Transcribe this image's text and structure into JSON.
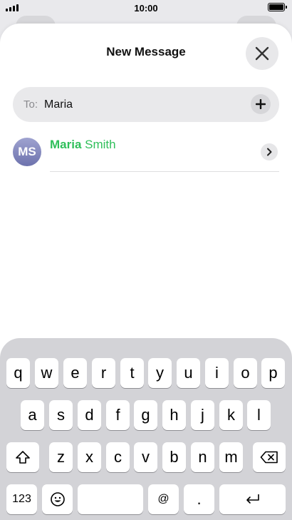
{
  "status": {
    "time": "10:00"
  },
  "sheet": {
    "title": "New Message",
    "to_label": "To:",
    "to_value": "Maria"
  },
  "suggestion": {
    "initials": "MS",
    "name_match": "Maria",
    "name_rest": " Smith"
  },
  "keyboard": {
    "row1": [
      "q",
      "w",
      "e",
      "r",
      "t",
      "y",
      "u",
      "i",
      "o",
      "p"
    ],
    "row2": [
      "a",
      "s",
      "d",
      "f",
      "g",
      "h",
      "j",
      "k",
      "l"
    ],
    "row3": [
      "z",
      "x",
      "c",
      "v",
      "b",
      "n",
      "m"
    ],
    "numbers_label": "123",
    "at_label": "@",
    "period_label": "."
  },
  "icons": {
    "close": "close-icon",
    "add": "plus-icon",
    "chevron": "chevron-right-icon",
    "shift": "shift-icon",
    "delete": "delete-backward-icon",
    "emoji": "emoji-icon",
    "return": "return-icon"
  }
}
